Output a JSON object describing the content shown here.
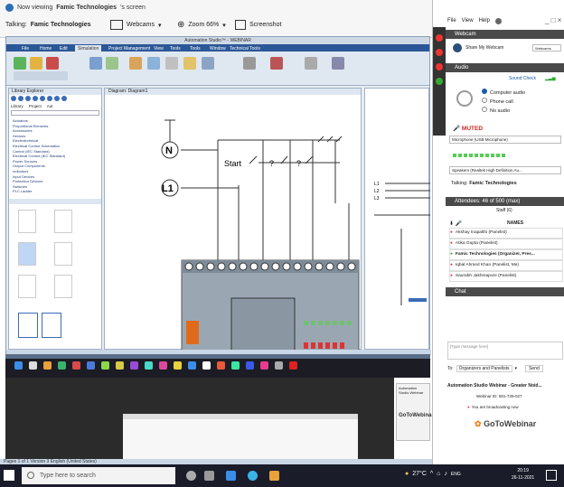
{
  "share": {
    "viewing_prefix": "Now viewing",
    "viewing_name": "Famic Technologies",
    "viewing_suffix": "'s screen",
    "talking_label": "Talking:",
    "talking_name": "Famic Technologies",
    "webcams_label": "Webcams",
    "zoom_label": "Zoom 66%",
    "screenshot_label": "Screenshot"
  },
  "app": {
    "title": "Automation Studio™ - WEBINAR",
    "tabs": [
      "File",
      "Home",
      "Edit",
      "Simulation",
      "Project Management",
      "View",
      "Tools",
      "Tools",
      "Window",
      "Technical Tools"
    ],
    "left_panel_title": "Library Explorer",
    "left_panel_tabs": [
      "Library",
      "Project",
      "Aut"
    ],
    "tree": [
      "Actuators",
      "Proportional Elements",
      "Accessories",
      "Devices",
      "Electrotechnical",
      "Electrical Control Schematics",
      "Control (IEC Standard)",
      "Electrical Control (IEC Standard)",
      "Power Sources",
      "Output Components",
      "Indicators",
      "Input Devices",
      "Protection Devices",
      "Switches",
      "PLC Ladder"
    ],
    "canvas_title": "Diagram: Diagram1",
    "labels": {
      "n": "N",
      "l1": "L1",
      "start": "Start",
      "q1": "?",
      "q2": "?"
    },
    "right_labels": [
      "L1",
      "L2",
      "L3"
    ],
    "status": "Pages 1 of 1    Version 3    English (United States)"
  },
  "presenter": {
    "webinar_title": "Automation Studio Webinar",
    "logo": "GoToWebinar"
  },
  "gtw": {
    "menu": [
      "File",
      "View",
      "Help"
    ],
    "webcam_header": "Webcam",
    "share_webcam": "Share My Webcam",
    "webcam_dropdown": "Webcams",
    "audio_header": "Audio",
    "sound_check": "Sound Check",
    "audio_options": [
      "Computer audio",
      "Phone call",
      "No audio"
    ],
    "muted": "MUTED",
    "microphone": "Microphone (USB Microphone)",
    "speakers": "Speakers (Realtek High Definition Au...",
    "talking_label": "Talking:",
    "talking_name": "Famic Technologies",
    "attendees_header": "Attendees: 46 of 500 (max)",
    "staff_label": "Staff (6)",
    "names_label": "NAMES",
    "attendees": [
      "Akshay Inapalthi (Panelist)",
      "Atika Gupta (Panelist)",
      "Famic Technologies (Organizer, Pres...",
      "Iqbal Ahmed Khan (Panelist, Me)",
      "Saurabh Jakhmapure (Panelist)"
    ],
    "chat_header": "Chat",
    "chat_placeholder": "[Type message here]",
    "to_label": "To:",
    "to_value": "Organizers and Panelists",
    "send_label": "Send",
    "webinar_name": "Automation Studio Webinar - Greater Noid...",
    "webinar_id": "Webinar ID: 581-739-027",
    "broadcasting": "You are broadcasting now",
    "logo": "GoToWebinar"
  },
  "taskbar": {
    "search_placeholder": "Type here to search",
    "temperature": "27°C",
    "lang": "ENG",
    "time": "20:19",
    "date": "26-11-2021"
  }
}
